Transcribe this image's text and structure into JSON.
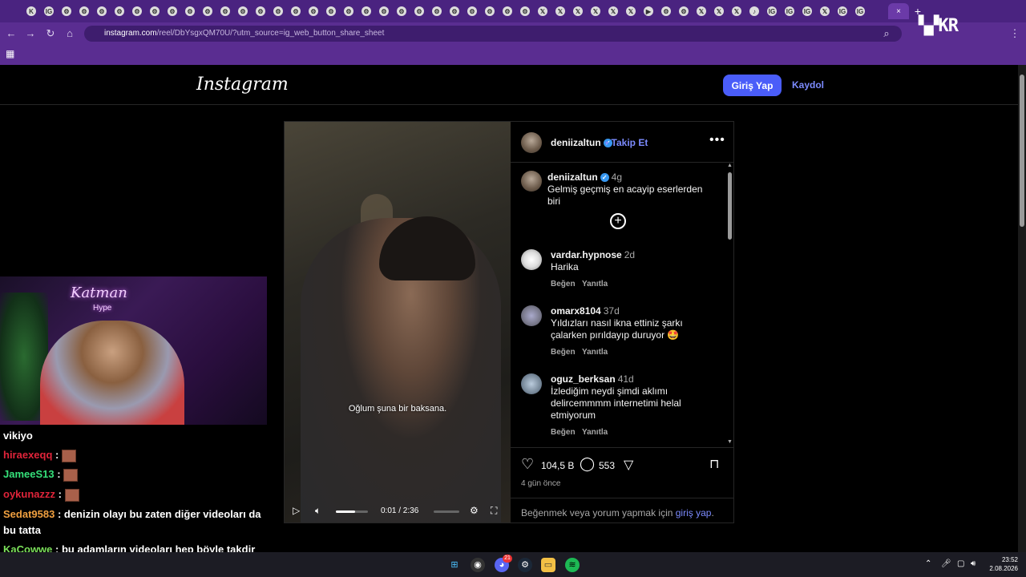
{
  "browser": {
    "tabs": [
      "K",
      "IG",
      "⚙",
      "⚙",
      "⚙",
      "⚙",
      "⚙",
      "⚙",
      "⚙",
      "⚙",
      "⚙",
      "⚙",
      "⚙",
      "⚙",
      "⚙",
      "⚙",
      "⚙",
      "⚙",
      "⚙",
      "⚙",
      "⚙",
      "⚙",
      "⚙",
      "⚙",
      "⚙",
      "⚙",
      "⚙",
      "⚙",
      "⚙",
      "𝕏",
      "𝕏",
      "𝕏",
      "𝕏",
      "𝕏",
      "𝕏",
      "▶",
      "⚙",
      "⚙",
      "𝕏",
      "𝕏",
      "𝕏",
      "♪",
      "IG",
      "IG",
      "IG",
      "𝕏",
      "IG",
      "IG"
    ],
    "close_tab": "×",
    "new_tab": "+",
    "url_host": "instagram.com",
    "url_rest": "/reel/DbYsgxQM70U/?utm_source=ig_web_button_share_sheet",
    "overlay_logo": "▚▞KR"
  },
  "header": {
    "logo": "Instagram",
    "login_button": "Giriş Yap",
    "signup_link": "Kaydol"
  },
  "video": {
    "subtitle": "Oğlum şuna bir baksana.",
    "time": "0:01 / 2:36"
  },
  "post": {
    "author": "deniizaltun",
    "follow": "Takip Et",
    "caption_author": "deniizaltun",
    "caption_age": "4g",
    "caption": "Gelmiş geçmiş en acayip eserlerden biri",
    "comments": [
      {
        "user": "vardar.hypnose",
        "age": "2d",
        "text": "Harika",
        "like": "Beğen",
        "reply": "Yanıtla"
      },
      {
        "user": "omarx8104",
        "age": "37d",
        "text": "Yıldızları nasıl ikna ettiniz şarkı çalarken pırıldayıp duruyor 🤩",
        "like": "Beğen",
        "reply": "Yanıtla"
      },
      {
        "user": "oguz_berksan",
        "age": "41d",
        "text": "İzlediğim neydi şimdi aklımı delircemmmm internetimi helal etmiyorum",
        "like": "Beğen",
        "reply": "Yanıtla"
      }
    ],
    "likes": "104,5 B",
    "comment_count": "553",
    "date": "4 gün önce",
    "login_prompt_pre": "Beğenmek veya yorum yapmak için ",
    "login_prompt_link": "giriş yap",
    "login_prompt_post": "."
  },
  "stream": {
    "neon_sign": "Katman",
    "neon_sub": "Hype",
    "chat": [
      {
        "user": "",
        "text": "vikiyo",
        "color": "#ffffff"
      },
      {
        "user": "hiraexeqq",
        "text": "",
        "color": "#e0243a",
        "emote": true
      },
      {
        "user": "JameeS13",
        "text": "",
        "color": "#35e07a",
        "emote": true
      },
      {
        "user": "oykunazzz",
        "text": "",
        "color": "#e0243a",
        "emote": true
      },
      {
        "user": "Sedat9583",
        "text": "denizin olayı bu zaten diğer videoları da bu tatta",
        "color": "#f0a040"
      },
      {
        "user": "KaCowwe",
        "text": "bu adamların videoları hep böyle takdir ediyorum cidden",
        "color": "#7be05a"
      }
    ]
  },
  "taskbar": {
    "time": "23:52",
    "date": "2.08.2026",
    "badge": "21"
  }
}
